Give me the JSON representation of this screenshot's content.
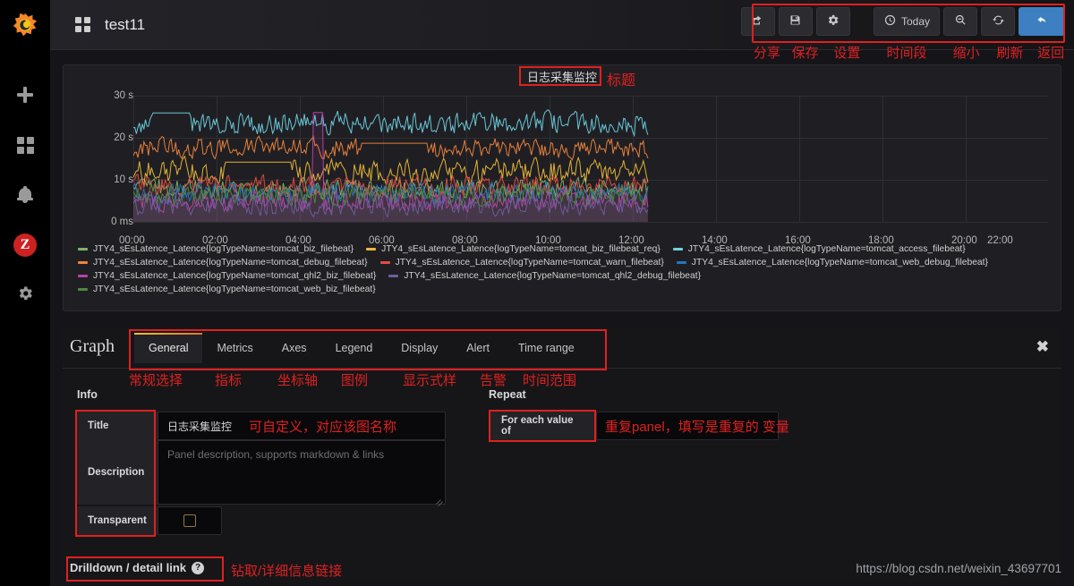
{
  "app": {
    "brand_icon": "grafana-logo-icon",
    "dashboard_title": "test11"
  },
  "sidebar": {
    "items": [
      {
        "name": "create-add",
        "icon": "plus-icon",
        "label": ""
      },
      {
        "name": "dashboards",
        "icon": "grid-icon",
        "label": ""
      },
      {
        "name": "alerting",
        "icon": "bell-icon",
        "label": ""
      },
      {
        "name": "user-profile",
        "icon": "avatar-icon",
        "label": "Z"
      },
      {
        "name": "configuration",
        "icon": "gear-icon",
        "label": ""
      }
    ],
    "avatar_color": "#cc2222"
  },
  "toolbar": {
    "buttons": [
      {
        "name": "share",
        "icon": "share-icon",
        "label": ""
      },
      {
        "name": "save",
        "icon": "save-icon",
        "label": ""
      },
      {
        "name": "settings",
        "icon": "gear-icon",
        "label": ""
      },
      {
        "name": "time-range",
        "icon": "clock-icon",
        "label": "Today"
      },
      {
        "name": "zoom-out",
        "icon": "search-minus-icon",
        "label": ""
      },
      {
        "name": "refresh",
        "icon": "refresh-icon",
        "label": ""
      },
      {
        "name": "back",
        "icon": "arrow-back-icon",
        "label": ""
      }
    ],
    "annotations": [
      "分享",
      "保存",
      "设置",
      "时间段",
      "缩小",
      "刷新",
      "返回"
    ],
    "highlight_color": "#e02020"
  },
  "panel": {
    "title": "日志采集监控",
    "title_annotation": "标题"
  },
  "chart_data": {
    "type": "line",
    "title": "日志采集监控",
    "xlabel": "",
    "ylabel": "",
    "ylim": [
      0,
      30
    ],
    "ytick_labels": [
      "30 s",
      "20 s",
      "10 s",
      "0 ms"
    ],
    "ytick_values": [
      30,
      20,
      10,
      0
    ],
    "xtick_labels": [
      "00:00",
      "02:00",
      "04:00",
      "06:00",
      "08:00",
      "10:00",
      "12:00",
      "14:00",
      "16:00",
      "18:00",
      "20:00",
      "22:00"
    ],
    "grid": true,
    "legend_position": "bottom",
    "data_end_x": "13:30",
    "series": [
      {
        "name": "JTY4_sEsLatence_Latence{logTypeName=tomcat_biz_filebeat}",
        "color": "#7eb26d",
        "mean": 8.0
      },
      {
        "name": "JTY4_sEsLatence_Latence{logTypeName=tomcat_biz_filebeat_req}",
        "color": "#eab839",
        "mean": 12.0
      },
      {
        "name": "JTY4_sEsLatence_Latence{logTypeName=tomcat_access_filebeat}",
        "color": "#6ed0e0",
        "mean": 23.5
      },
      {
        "name": "JTY4_sEsLatence_Latence{logTypeName=tomcat_debug_filebeat}",
        "color": "#ef843c",
        "mean": 17.5
      },
      {
        "name": "JTY4_sEsLatence_Latence{logTypeName=tomcat_warn_filebeat}",
        "color": "#e24d42",
        "mean": 8.5
      },
      {
        "name": "JTY4_sEsLatence_Latence{logTypeName=tomcat_web_debug_filebeat}",
        "color": "#1f78c1",
        "mean": 7.0
      },
      {
        "name": "JTY4_sEsLatence_Latence{logTypeName=tomcat_qhl2_biz_filebeat}",
        "color": "#ba43a9",
        "mean": 5.0
      },
      {
        "name": "JTY4_sEsLatence_Latence{logTypeName=tomcat_qhl2_debug_filebeat}",
        "color": "#705da0",
        "mean": 4.0
      },
      {
        "name": "JTY4_sEsLatence_Latence{logTypeName=tomcat_web_biz_filebeat}",
        "color": "#508642",
        "mean": 6.5
      }
    ]
  },
  "editor": {
    "title": "Graph",
    "close_label": "✖",
    "tabs": [
      {
        "label": "General",
        "active": true
      },
      {
        "label": "Metrics",
        "active": false
      },
      {
        "label": "Axes",
        "active": false
      },
      {
        "label": "Legend",
        "active": false
      },
      {
        "label": "Display",
        "active": false
      },
      {
        "label": "Alert",
        "active": false
      },
      {
        "label": "Time range",
        "active": false
      }
    ],
    "tab_annotations": [
      "常规选择",
      "指标",
      "坐标轴",
      "图例",
      "显示式样",
      "告警",
      "时间范围"
    ],
    "info_section": "Info",
    "repeat_section": "Repeat",
    "fields": {
      "title_label": "Title",
      "title_value": "日志采集监控",
      "title_annotation": "可自定义，对应该图名称",
      "description_label": "Description",
      "description_placeholder": "Panel description, supports markdown & links",
      "transparent_label": "Transparent",
      "repeat_label": "For each value of",
      "repeat_annotation": "重复panel，填写是重复的 变量"
    },
    "drilldown_label": "Drilldown / detail link",
    "drilldown_help": "?",
    "drilldown_annotation": "钻取/详细信息链接"
  },
  "watermark": "https://blog.csdn.net/weixin_43697701"
}
